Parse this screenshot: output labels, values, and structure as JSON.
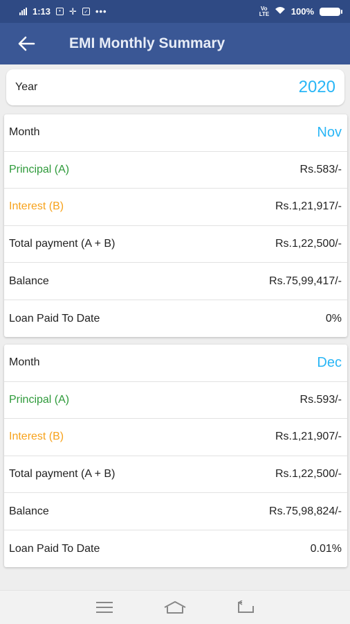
{
  "status_bar": {
    "time": "1:13",
    "network": "Vo LTE",
    "battery": "100%"
  },
  "app_bar": {
    "title": "EMI Monthly Summary"
  },
  "year_card": {
    "label": "Year",
    "value": "2020"
  },
  "months": [
    {
      "month_label": "Month",
      "month_value": "Nov",
      "principal_label": "Principal (A)",
      "principal_value": "Rs.583/-",
      "interest_label": "Interest (B)",
      "interest_value": "Rs.1,21,917/-",
      "total_label": "Total payment (A + B)",
      "total_value": "Rs.1,22,500/-",
      "balance_label": "Balance",
      "balance_value": "Rs.75,99,417/-",
      "paid_label": "Loan Paid To Date",
      "paid_value": "0%"
    },
    {
      "month_label": "Month",
      "month_value": "Dec",
      "principal_label": "Principal (A)",
      "principal_value": "Rs.593/-",
      "interest_label": "Interest (B)",
      "interest_value": "Rs.1,21,907/-",
      "total_label": "Total payment (A + B)",
      "total_value": "Rs.1,22,500/-",
      "balance_label": "Balance",
      "balance_value": "Rs.75,98,824/-",
      "paid_label": "Loan Paid To Date",
      "paid_value": "0.01%"
    }
  ],
  "colors": {
    "app_bar": "#3a5795",
    "status_bar": "#2f4a84",
    "accent_blue": "#29b6f6",
    "principal_green": "#2e9a3a",
    "interest_orange": "#f7a21b"
  },
  "icons": {
    "back": "arrow-left-icon",
    "menu": "menu-icon",
    "home": "home-icon",
    "recents": "back-nav-icon"
  }
}
